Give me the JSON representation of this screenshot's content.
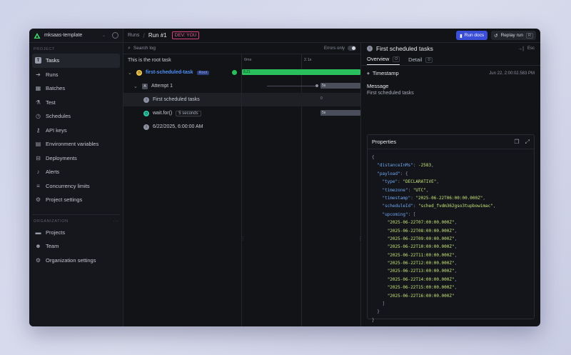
{
  "sidebar": {
    "org": "mksaas-template",
    "project_section": "PROJECT",
    "items": [
      {
        "label": "Tasks",
        "icon": "tasks-icon"
      },
      {
        "label": "Runs",
        "icon": "runs-icon"
      },
      {
        "label": "Batches",
        "icon": "batches-icon"
      },
      {
        "label": "Test",
        "icon": "test-icon"
      },
      {
        "label": "Schedules",
        "icon": "clock-icon"
      },
      {
        "label": "API keys",
        "icon": "key-icon"
      },
      {
        "label": "Environment variables",
        "icon": "env-icon"
      },
      {
        "label": "Deployments",
        "icon": "deploy-icon"
      },
      {
        "label": "Alerts",
        "icon": "bell-icon"
      },
      {
        "label": "Concurrency limits",
        "icon": "concurrency-icon"
      },
      {
        "label": "Project settings",
        "icon": "gear-icon"
      }
    ],
    "org_section": "ORGANIZATION",
    "org_items": [
      {
        "label": "Projects",
        "icon": "folder-icon"
      },
      {
        "label": "Team",
        "icon": "team-icon"
      },
      {
        "label": "Organization settings",
        "icon": "gear-icon"
      }
    ]
  },
  "topbar": {
    "crumb_runs": "Runs",
    "crumb_current": "Run #1",
    "env_badge": "DEV: YOU",
    "docs_label": "Run docs",
    "replay_label": "Replay run",
    "replay_key": "R"
  },
  "trace": {
    "search_placeholder": "Search log",
    "errors_label": "Errors only",
    "root_label": "This is the root task",
    "tick_0": "0ms",
    "tick_1": "2.1s",
    "rows": {
      "task": {
        "name": "first-scheduled-task",
        "badge": "Root",
        "duration": "8.21"
      },
      "attempt": {
        "label": "Attempt 1",
        "duration": "5s"
      },
      "log": {
        "label": "First scheduled tasks",
        "duration": "0"
      },
      "wait": {
        "label": "wait.for()",
        "pill": "5 seconds",
        "duration": "5s"
      },
      "date": {
        "label": "6/22/2025, 6:00:00 AM"
      }
    }
  },
  "detail": {
    "title": "First scheduled tasks",
    "esc": "Esc",
    "tab_overview": "Overview",
    "tab_overview_key": "O",
    "tab_detail": "Detail",
    "tab_detail_key": "D",
    "timestamp_label": "Timestamp",
    "timestamp_value": "Jun 22, 2:00:02.583 PM",
    "message_label": "Message",
    "message_value": "First scheduled tasks",
    "properties_label": "Properties",
    "json": {
      "distanceInMs": "-2583",
      "type": "\"DECLARATIVE\"",
      "timezone": "\"UTC\"",
      "timestamp": "\"2025-06-22T06:00:00.000Z\"",
      "scheduleId": "\"sched_fvdm362gso3tupbowimac\"",
      "upcoming": [
        "\"2025-06-22T07:00:00.000Z\"",
        "\"2025-06-22T08:00:00.000Z\"",
        "\"2025-06-22T09:00:00.000Z\"",
        "\"2025-06-22T10:00:00.000Z\"",
        "\"2025-06-22T11:00:00.000Z\"",
        "\"2025-06-22T12:00:00.000Z\"",
        "\"2025-06-22T13:00:00.000Z\"",
        "\"2025-06-22T14:00:00.000Z\"",
        "\"2025-06-22T15:00:00.000Z\"",
        "\"2025-06-22T16:00:00.000Z\""
      ]
    }
  },
  "colors": {
    "accent": "#3b4ed8",
    "success": "#28bf5c",
    "dev": "#ea5a91",
    "link": "#4e8ff5"
  }
}
